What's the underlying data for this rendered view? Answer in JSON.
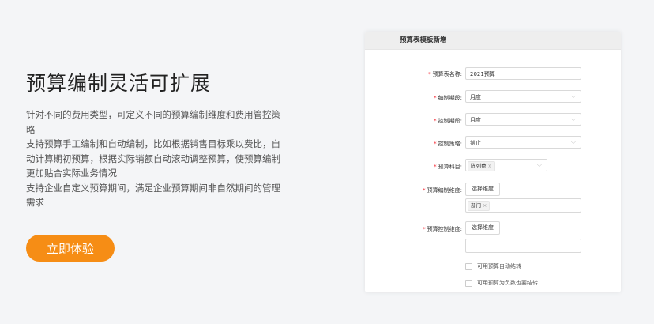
{
  "hero": {
    "title": "预算编制灵活可扩展",
    "desc": [
      "针对不同的费用类型，可定义不同的预算编制维度和费用管控策略",
      "支持预算手工编制和自动编制，比如根据销售目标乘以费比，自动计算期初预算，根据实际销额自动滚动调整预算，使预算编制更加贴合实际业务情况",
      "支持企业自定义预算期间，满足企业预算期间非自然期间的管理需求"
    ],
    "cta_label": "立即体验"
  },
  "colors": {
    "accent": "#f68d15",
    "required": "#f5222d"
  },
  "form": {
    "header": "预算表模板新增",
    "name": {
      "label": "预算表名称:",
      "value": "2021预算"
    },
    "plan_period": {
      "label": "编制期段:",
      "value": "月度"
    },
    "control_period": {
      "label": "控制期段:",
      "value": "月度"
    },
    "control_strategy": {
      "label": "控制策略:",
      "value": "禁止"
    },
    "budget_subject": {
      "label": "预算科目:",
      "tag": "陈列费"
    },
    "plan_dimension": {
      "label": "预算编制维度:",
      "button": "选择维度",
      "tag": "部门"
    },
    "control_dimension": {
      "label": "预算控制维度:",
      "button": "选择维度"
    },
    "checkbox_auto": "可用预算自动结转",
    "checkbox_negative": "可用预算为负数也要结转"
  }
}
